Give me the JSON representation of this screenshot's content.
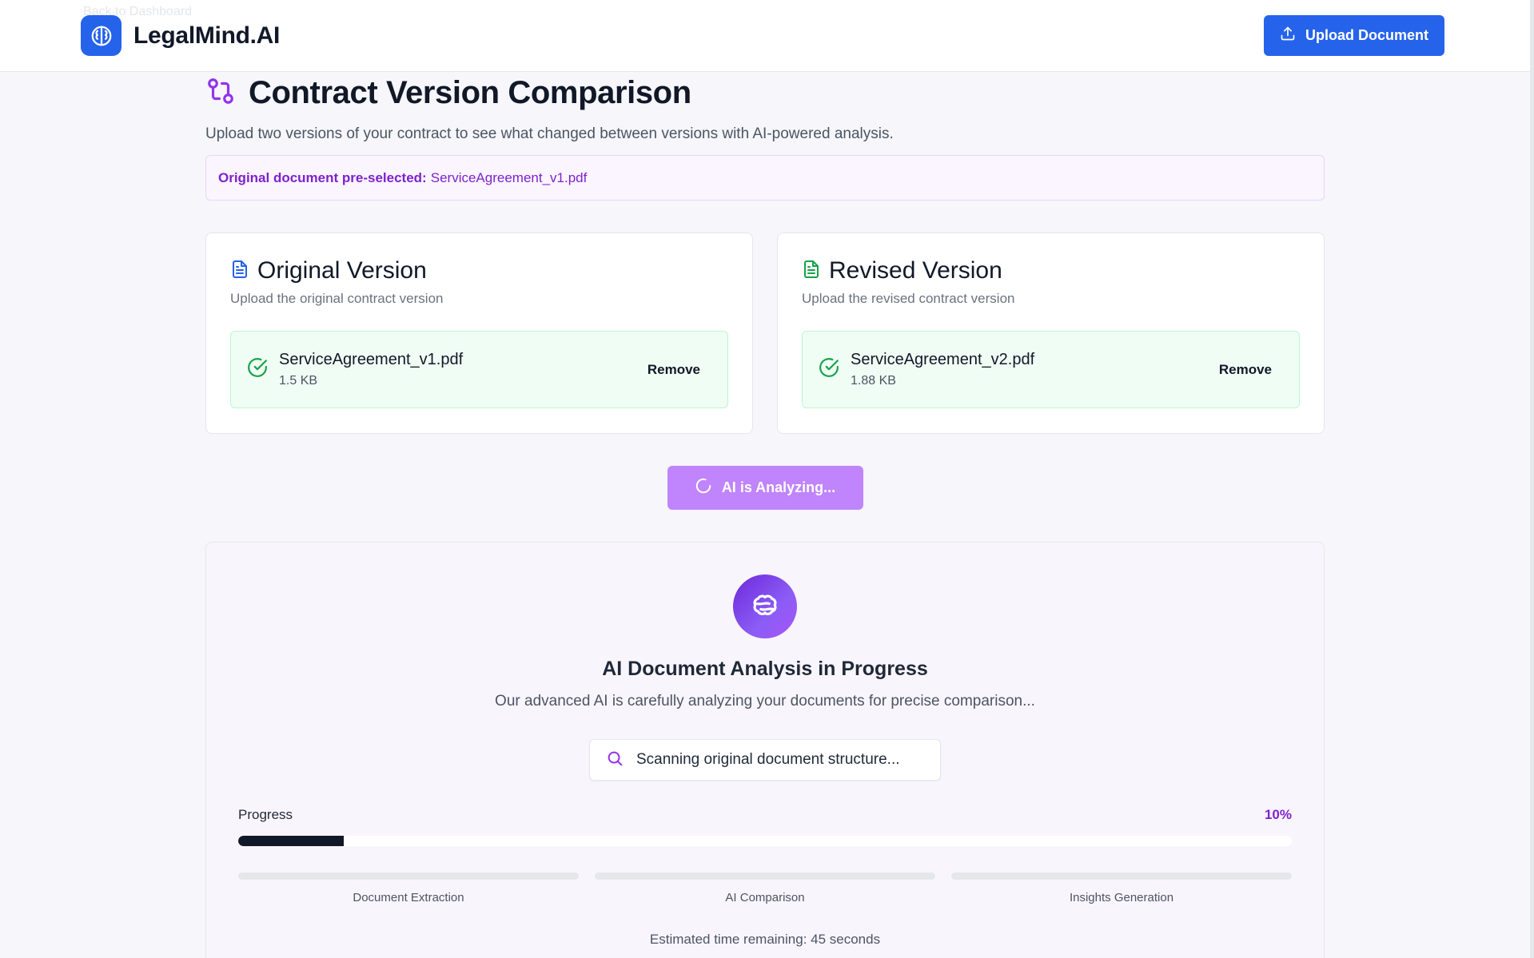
{
  "header": {
    "brand_name": "LegalMind.AI",
    "back_link": "Back to Dashboard",
    "upload_button": "Upload Document",
    "accent": "#2563eb"
  },
  "page": {
    "title": "Contract Version Comparison",
    "subtitle": "Upload two versions of your contract to see what changed between versions with AI-powered analysis.",
    "preselect_label": "Original document pre-selected:",
    "preselect_file": "ServiceAgreement_v1.pdf"
  },
  "cards": {
    "original": {
      "title": "Original Version",
      "description": "Upload the original contract version",
      "file_name": "ServiceAgreement_v1.pdf",
      "file_size": "1.5 KB",
      "remove_label": "Remove",
      "icon": "file-text-icon"
    },
    "revised": {
      "title": "Revised Version",
      "description": "Upload the revised contract version",
      "file_name": "ServiceAgreement_v2.pdf",
      "file_size": "1.88 KB",
      "remove_label": "Remove",
      "icon": "file-text-icon"
    }
  },
  "analyze_button": "AI is Analyzing...",
  "analysis": {
    "title": "AI Document Analysis in Progress",
    "description": "Our advanced AI is carefully analyzing your documents for precise comparison...",
    "status": "Scanning original document structure...",
    "progress_label": "Progress",
    "progress_percent": "10%",
    "progress_value": 0.1,
    "stages": [
      {
        "label": "Document Extraction"
      },
      {
        "label": "AI Comparison"
      },
      {
        "label": "Insights Generation"
      }
    ],
    "eta": "Estimated time remaining: 45 seconds"
  },
  "colors": {
    "purple": "#7e22ce",
    "green": "#16a34a",
    "blue": "#2563eb"
  }
}
